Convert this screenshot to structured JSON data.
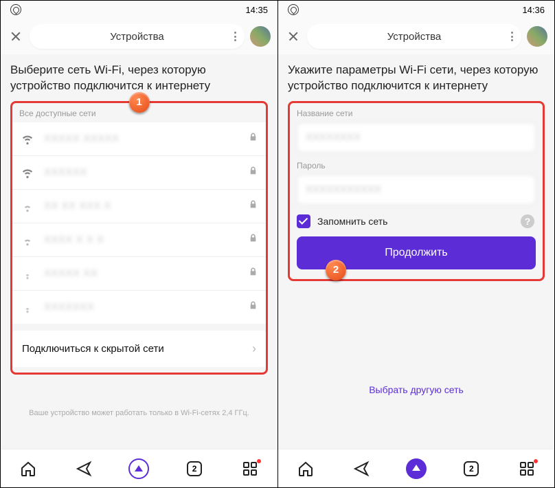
{
  "left": {
    "time": "14:35",
    "title": "Устройства",
    "heading": "Выберите сеть Wi-Fi, через которую устройство подключится к интернету",
    "section_label": "Все доступные сети",
    "networks": [
      {
        "name": "XXXXX XXXXX"
      },
      {
        "name": "XXXXXX"
      },
      {
        "name": "XX XX XXX X"
      },
      {
        "name": "XXXX X X X"
      },
      {
        "name": "XXXXX XX"
      },
      {
        "name": "XXXXXXX"
      }
    ],
    "hidden_network": "Подключиться к скрытой сети",
    "footer_note": "Ваше устройство может работать только в Wi-Fi-сетях 2,4 ГГц.",
    "badge": "1",
    "tab_count": "2"
  },
  "right": {
    "time": "14:36",
    "title": "Устройства",
    "heading": "Укажите параметры Wi-Fi сети, через которую устройство подключится к интернету",
    "name_label": "Название сети",
    "name_value": "XXXXXXXX",
    "password_label": "Пароль",
    "password_value": "XXXXXXXXXXX",
    "remember": "Запомнить сеть",
    "continue": "Продолжить",
    "alt_link": "Выбрать другую сеть",
    "badge": "2",
    "tab_count": "2"
  }
}
